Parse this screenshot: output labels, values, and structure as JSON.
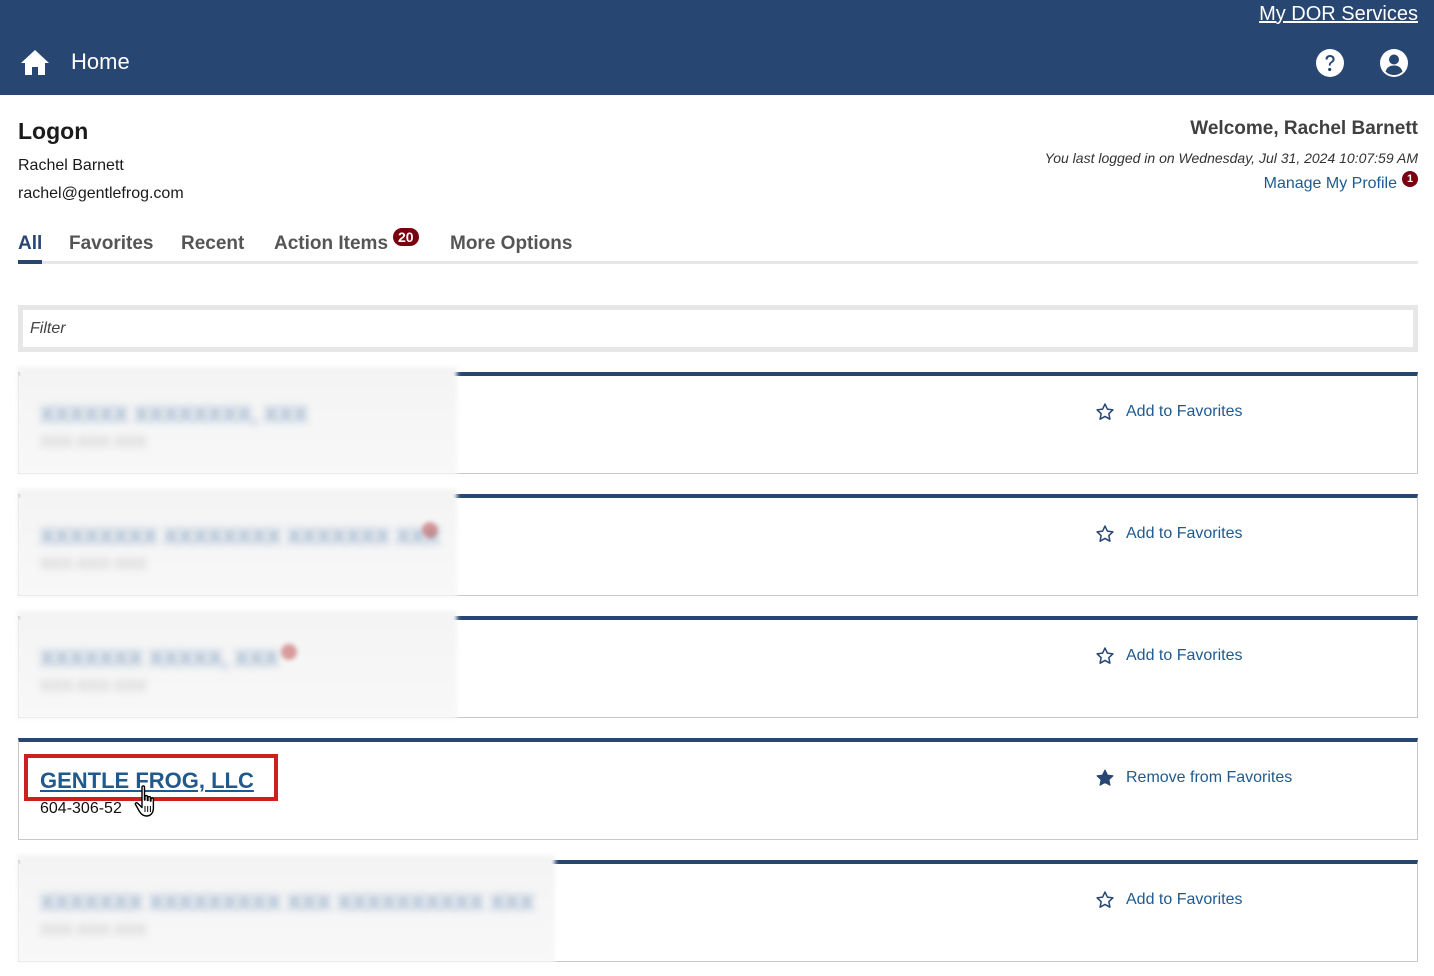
{
  "header": {
    "dor_services_label": "My DOR Services",
    "home_label": "Home"
  },
  "logon": {
    "title": "Logon",
    "name": "Rachel Barnett",
    "email": "rachel@gentlefrog.com"
  },
  "welcome": {
    "greeting": "Welcome, Rachel Barnett",
    "last_login": "You last logged in on Wednesday, Jul 31, 2024 10:07:59 AM",
    "manage_profile_label": "Manage My Profile",
    "manage_profile_badge": "1"
  },
  "tabs": {
    "all": "All",
    "favorites": "Favorites",
    "recent": "Recent",
    "action_items": "Action Items",
    "action_items_badge": "20",
    "more_options": "More Options"
  },
  "filter": {
    "placeholder": "Filter"
  },
  "cards": [
    {
      "fav_label": "Add to Favorites"
    },
    {
      "fav_label": "Add to Favorites"
    },
    {
      "fav_label": "Add to Favorites"
    },
    {
      "name": "GENTLE FROG, LLC",
      "phone": "604-306-52",
      "fav_label": "Remove from Favorites"
    },
    {
      "fav_label": "Add to Favorites"
    }
  ],
  "colors": {
    "header_bg": "#274672",
    "link": "#1f5a8f",
    "badge": "#7a0010",
    "highlight": "#cc1f1f"
  },
  "icons": {
    "home": "home-icon",
    "help": "help-circle-icon",
    "user": "user-circle-icon",
    "star_outline": "star-outline-icon",
    "star_filled": "star-filled-icon",
    "pointer": "hand-pointer-icon"
  }
}
